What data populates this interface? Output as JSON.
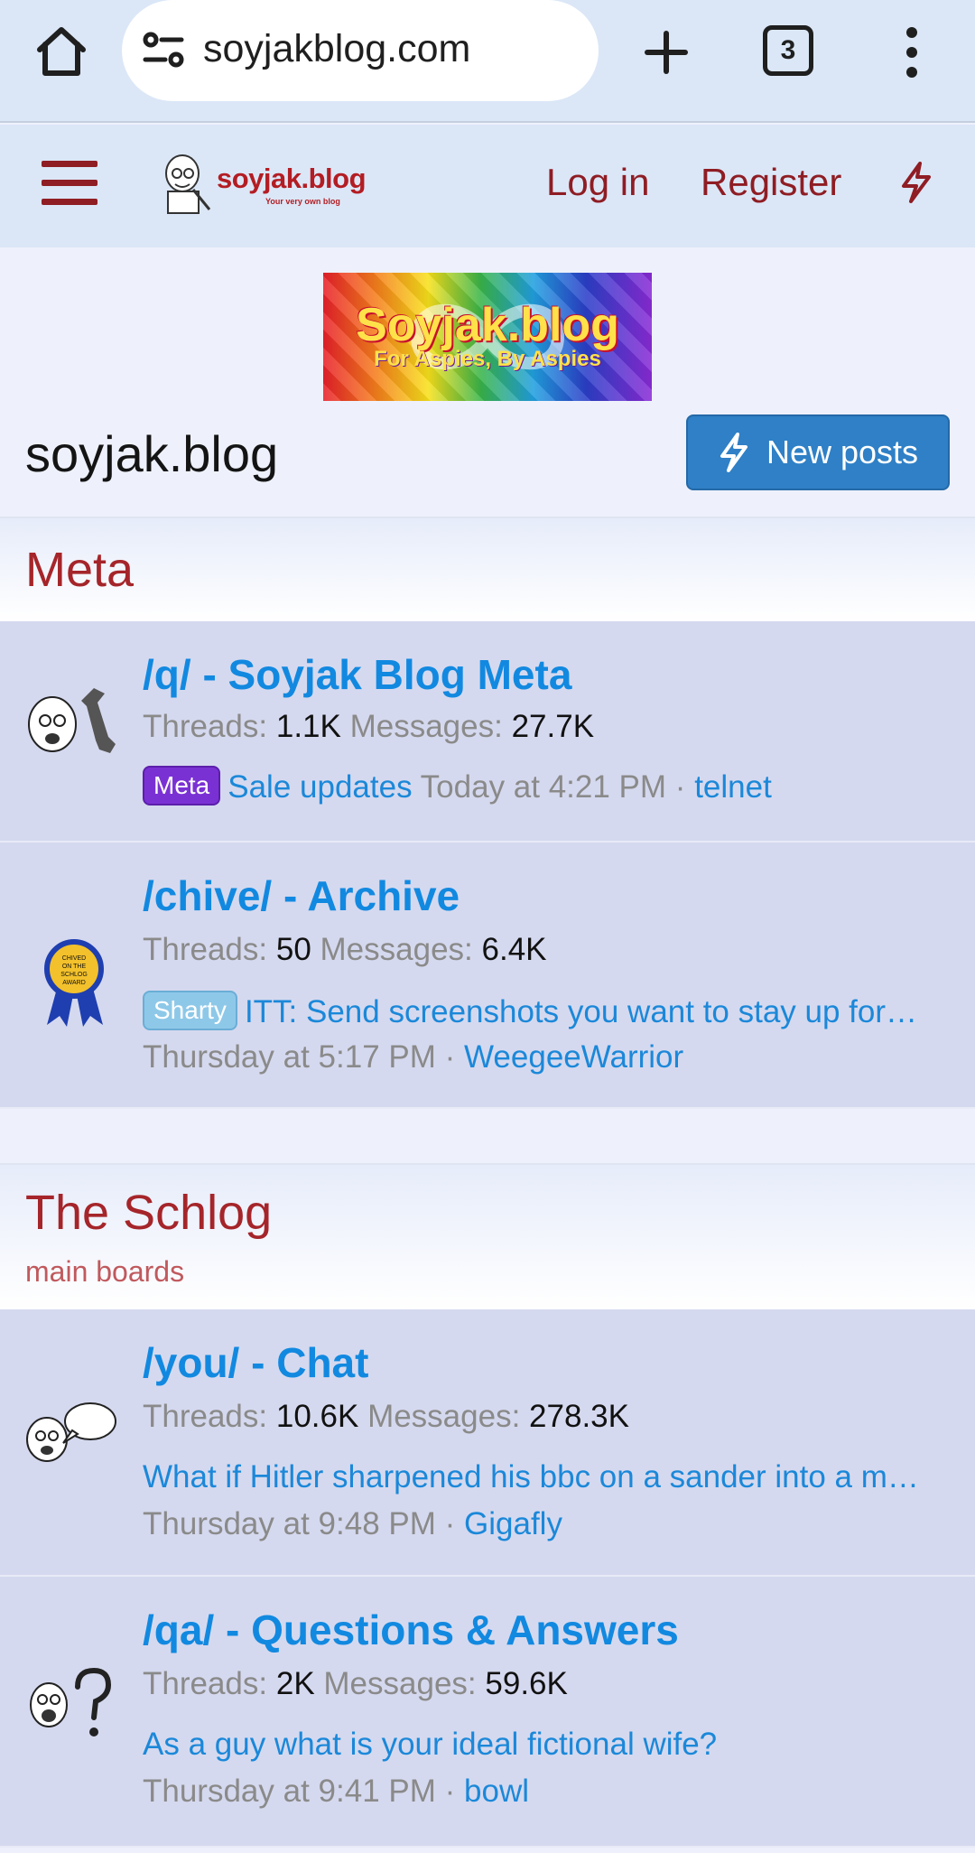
{
  "browser": {
    "url": "soyjakblog.com",
    "tab_count": "3"
  },
  "header": {
    "logo_text": "soyjak.blog",
    "logo_tagline": "Your very own blog",
    "login": "Log in",
    "register": "Register"
  },
  "banner": {
    "title": "Soyjak.blog",
    "subtitle": "For Aspies, By Aspies"
  },
  "page": {
    "title": "soyjak.blog",
    "new_posts": "New posts"
  },
  "categories": [
    {
      "title": "Meta",
      "description": "",
      "nodes": [
        {
          "title": "/q/ - Soyjak Blog Meta",
          "threads_label": "Threads:",
          "threads": "1.1K",
          "messages_label": "Messages:",
          "messages": "27.7K",
          "prefix": "Meta",
          "latest_title": "Sale updates",
          "latest_time": "Today at 4:21 PM",
          "sep": "·",
          "latest_user": "telnet"
        },
        {
          "title": "/chive/ - Archive",
          "threads_label": "Threads:",
          "threads": "50",
          "messages_label": "Messages:",
          "messages": "6.4K",
          "prefix": "Sharty",
          "latest_title": "ITT: Send screenshots you want to stay up for…",
          "latest_time": "Thursday at 5:17 PM",
          "sep": "·",
          "latest_user": "WeegeeWarrior",
          "icon_text": "CHIVED ON THE SCHLOG AWARD"
        }
      ]
    },
    {
      "title": "The Schlog",
      "description": "main boards",
      "nodes": [
        {
          "title": "/you/ - Chat",
          "threads_label": "Threads:",
          "threads": "10.6K",
          "messages_label": "Messages:",
          "messages": "278.3K",
          "latest_title": "What if Hitler sharpened his bbc on a sander into a m…",
          "latest_time": "Thursday at 9:48 PM",
          "sep": "·",
          "latest_user": "Gigafly"
        },
        {
          "title": "/qa/ - Questions & Answers",
          "threads_label": "Threads:",
          "threads": "2K",
          "messages_label": "Messages:",
          "messages": "59.6K",
          "latest_title": "As a guy what is your ideal fictional wife?",
          "latest_time": "Thursday at 9:41 PM",
          "sep": "·",
          "latest_user": "bowl"
        }
      ]
    }
  ],
  "colors": {
    "brand_red": "#8f1d24",
    "link_blue": "#1289e0",
    "button_blue": "#2f80c6",
    "node_bg": "#d5d9ef"
  }
}
